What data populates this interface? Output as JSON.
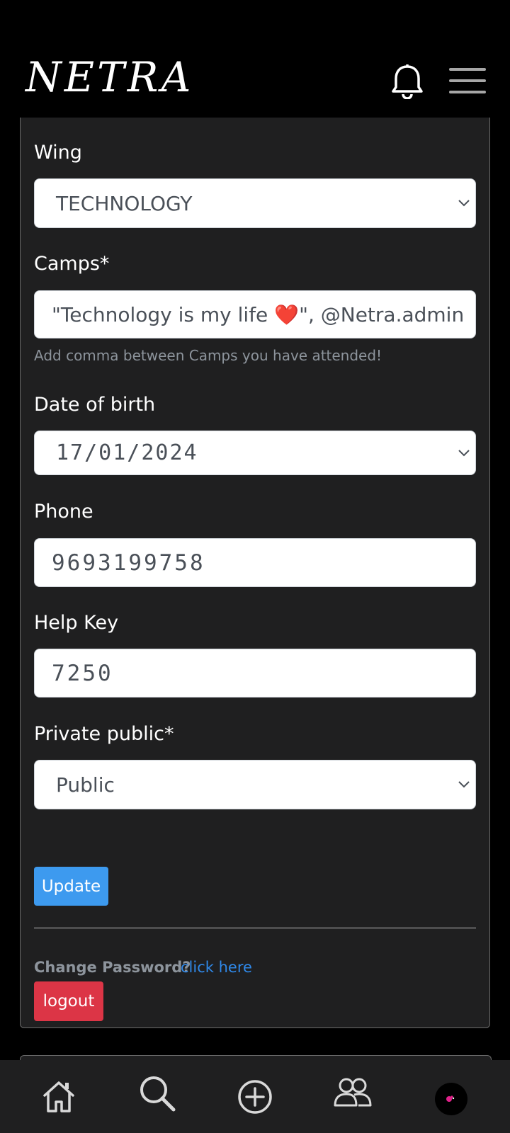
{
  "header": {
    "logo": "NETRA"
  },
  "form": {
    "wing": {
      "label": "Wing",
      "value": "TECHNOLOGY"
    },
    "camps": {
      "label": "Camps*",
      "value_before_heart": "\"Technology is my life ",
      "heart": "❤️",
      "value_after_heart": "\", @Netra.admin",
      "hint": "Add comma between Camps you have attended!"
    },
    "dob": {
      "label": "Date of birth",
      "value": "17/01/2024"
    },
    "phone": {
      "label": "Phone",
      "value": "9693199758"
    },
    "help_key": {
      "label": "Help Key",
      "value": "7250"
    },
    "privacy": {
      "label": "Private public*",
      "value": "Public"
    },
    "update_label": "Update",
    "change_password_label": "Change Password?",
    "change_password_link": "click here",
    "logout_label": "logout"
  },
  "colors": {
    "background": "#000000",
    "card": "#1f1f20",
    "update_button": "#3d9aef",
    "logout_button": "#dc3546",
    "link": "#2f88e8"
  },
  "bottom_nav": {
    "items": [
      "home-icon",
      "search-icon",
      "add-circle-icon",
      "people-icon",
      "avatar"
    ]
  }
}
